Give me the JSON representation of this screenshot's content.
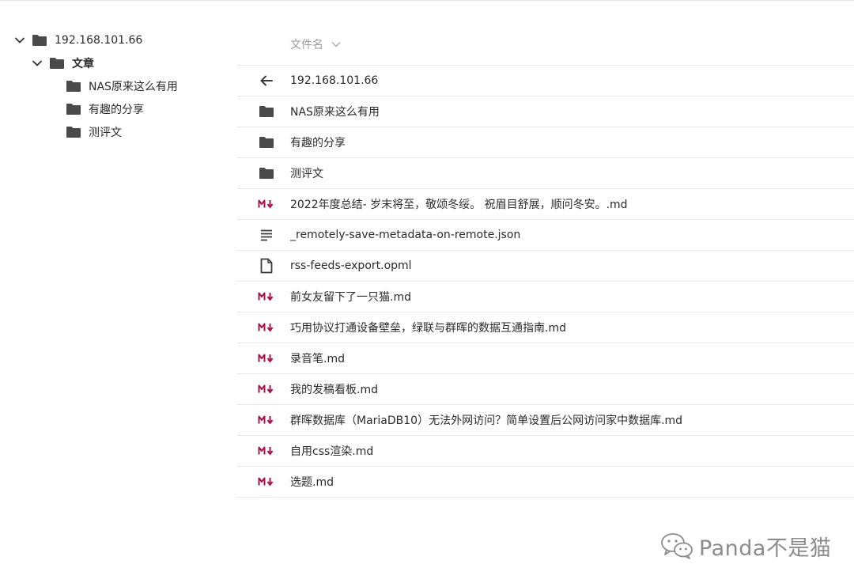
{
  "tree": {
    "root": {
      "label": "192.168.101.66",
      "expanded": true
    },
    "folder": {
      "label": "文章",
      "expanded": true
    },
    "children": [
      {
        "label": "NAS原来这么有用"
      },
      {
        "label": "有趣的分享"
      },
      {
        "label": "测评文"
      }
    ]
  },
  "list": {
    "sort_label": "文件名",
    "rows": [
      {
        "icon": "back-arrow-icon",
        "name": "192.168.101.66"
      },
      {
        "icon": "folder-icon",
        "name": "NAS原来这么有用"
      },
      {
        "icon": "folder-icon",
        "name": "有趣的分享"
      },
      {
        "icon": "folder-icon",
        "name": "测评文"
      },
      {
        "icon": "markdown-icon",
        "name": "2022年度总结- 岁末将至，敬颂冬绥。 祝眉目舒展，顺问冬安。.md"
      },
      {
        "icon": "text-lines-icon",
        "name": "_remotely-save-metadata-on-remote.json"
      },
      {
        "icon": "document-icon",
        "name": "rss-feeds-export.opml"
      },
      {
        "icon": "markdown-icon",
        "name": "前女友留下了一只猫.md"
      },
      {
        "icon": "markdown-icon",
        "name": "巧用协议打通设备壁垒，绿联与群晖的数据互通指南.md"
      },
      {
        "icon": "markdown-icon",
        "name": "录音笔.md"
      },
      {
        "icon": "markdown-icon",
        "name": "我的发稿看板.md"
      },
      {
        "icon": "markdown-icon",
        "name": "群晖数据库（MariaDB10）无法外网访问？简单设置后公网访问家中数据库.md"
      },
      {
        "icon": "markdown-icon",
        "name": "自用css渲染.md"
      },
      {
        "icon": "markdown-icon",
        "name": "选题.md"
      }
    ]
  },
  "watermark": {
    "text": "Panda不是猫",
    "icon": "wechat-icon"
  },
  "colors": {
    "text": "#2b2b2b",
    "muted": "#9a9a9a",
    "folder": "#4a4a4a",
    "markdown": "#a8134f",
    "divider": "#e6e6e6"
  }
}
